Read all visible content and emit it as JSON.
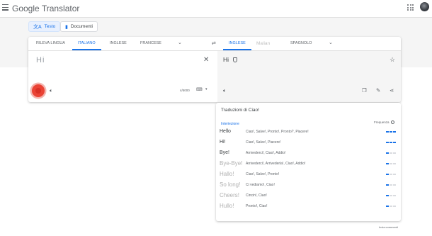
{
  "app": {
    "title": "Google Translator"
  },
  "modes": [
    {
      "label": "Testo",
      "icon": "translate-icon",
      "active": true
    },
    {
      "label": "Documenti",
      "icon": "document-icon",
      "active": false
    }
  ],
  "source_langs": [
    {
      "label": "RILEVA LINGUA",
      "active": false
    },
    {
      "label": "ITALIANO",
      "active": true
    },
    {
      "label": "INGLESE",
      "active": false
    },
    {
      "label": "FRANCESE",
      "active": false
    }
  ],
  "target_langs": [
    {
      "label": "INGLESE",
      "active": true
    },
    {
      "label": "Malian",
      "active": false
    },
    {
      "label": "SPAGNOLO",
      "active": false
    }
  ],
  "source": {
    "text": "Hi",
    "counter": "4/5000"
  },
  "target": {
    "text": "Hi"
  },
  "dictionary": {
    "title": "Traduzioni di Ciao!",
    "part_of_speech": "Interiezione",
    "frequency_label": "Frequenza",
    "entries": [
      {
        "word": "Hello",
        "translations": "Ciao!, Salve!, Pronto!, Pronto?, Piacere!",
        "frequency": 3
      },
      {
        "word": "Hi!",
        "translations": "Ciao!, Salve!, Piacere!",
        "frequency": 3
      },
      {
        "word": "Bye!",
        "translations": "Arrivederci!, Ciao!, Addio!",
        "frequency": 1
      },
      {
        "word": "Bye-Bye!",
        "translations": "Arrivederci!, Arrivederla!, Ciao!, Addio!",
        "frequency": 1
      },
      {
        "word": "Hallo!",
        "translations": "Ciao!, Salve!, Pronto!",
        "frequency": 1
      },
      {
        "word": "So long!",
        "translations": "Ci vediamo!, Ciao!",
        "frequency": 1
      },
      {
        "word": "Cheers!",
        "translations": "Cincin!, Ciao!",
        "frequency": 1
      },
      {
        "word": "Hullo!",
        "translations": "Pronto!, Ciao!",
        "frequency": 1
      }
    ]
  },
  "footer": {
    "feedback": "Invia commenti"
  },
  "colors": {
    "accent": "#1a73e8",
    "mic": "#ea4335"
  }
}
